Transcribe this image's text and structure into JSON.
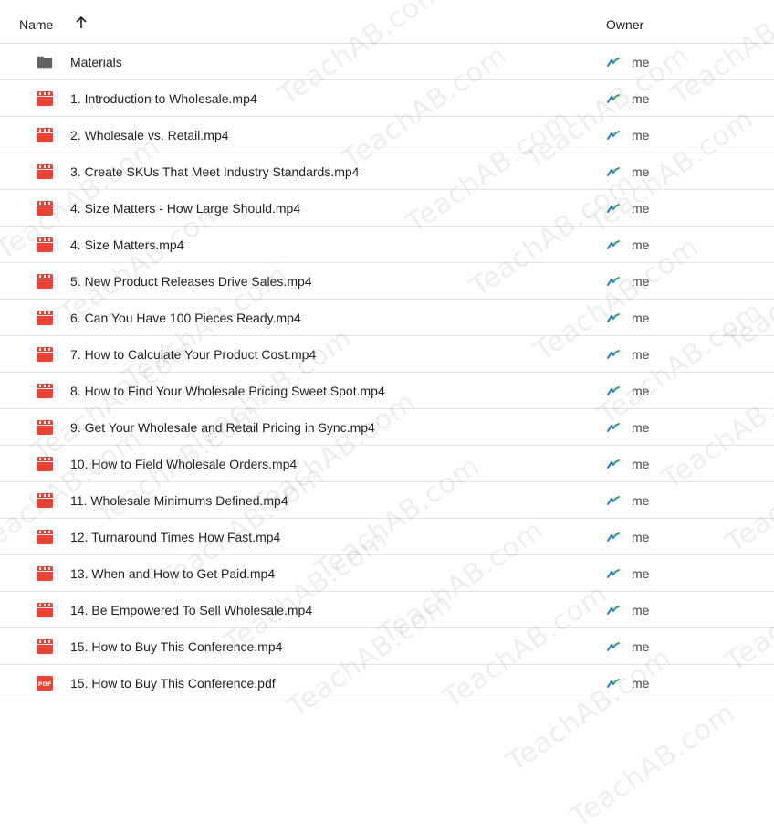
{
  "header": {
    "name_label": "Name",
    "owner_label": "Owner",
    "sort_icon": "arrow-up-icon"
  },
  "files": [
    {
      "name": "Materials",
      "type": "folder",
      "owner": "me"
    },
    {
      "name": "1. Introduction to Wholesale.mp4",
      "type": "video",
      "owner": "me"
    },
    {
      "name": "2. Wholesale vs. Retail.mp4",
      "type": "video",
      "owner": "me"
    },
    {
      "name": "3. Create SKUs That Meet Industry Standards.mp4",
      "type": "video",
      "owner": "me"
    },
    {
      "name": "4. Size Matters - How Large Should.mp4",
      "type": "video",
      "owner": "me"
    },
    {
      "name": "4. Size Matters.mp4",
      "type": "video",
      "owner": "me"
    },
    {
      "name": "5. New Product Releases Drive Sales.mp4",
      "type": "video",
      "owner": "me"
    },
    {
      "name": "6. Can You Have 100 Pieces Ready.mp4",
      "type": "video",
      "owner": "me"
    },
    {
      "name": "7. How to Calculate Your Product Cost.mp4",
      "type": "video",
      "owner": "me"
    },
    {
      "name": "8. How to Find Your Wholesale Pricing Sweet Spot.mp4",
      "type": "video",
      "owner": "me"
    },
    {
      "name": "9. Get Your Wholesale and Retail Pricing in Sync.mp4",
      "type": "video",
      "owner": "me"
    },
    {
      "name": "10. How to Field Wholesale Orders.mp4",
      "type": "video",
      "owner": "me"
    },
    {
      "name": "11. Wholesale Minimums Defined.mp4",
      "type": "video",
      "owner": "me"
    },
    {
      "name": "12. Turnaround Times How Fast.mp4",
      "type": "video",
      "owner": "me"
    },
    {
      "name": "13. When and How to Get Paid.mp4",
      "type": "video",
      "owner": "me"
    },
    {
      "name": "14. Be Empowered To Sell Wholesale.mp4",
      "type": "video",
      "owner": "me"
    },
    {
      "name": "15. How to Buy This Conference.mp4",
      "type": "video",
      "owner": "me"
    },
    {
      "name": "15. How to Buy This Conference.pdf",
      "type": "pdf",
      "owner": "me"
    }
  ],
  "icons": {
    "folder": "folder-icon",
    "video": "video-file-icon",
    "pdf": "pdf-file-icon",
    "owner": "shared-drive-owner-icon",
    "pdf_text": "PDF"
  },
  "colors": {
    "folder": "#5f6368",
    "video": "#ea4335",
    "pdf": "#ea4335",
    "owner_green": "#34a853",
    "owner_blue": "#1a73e8"
  },
  "watermark": {
    "text": "TeachAB.com"
  }
}
